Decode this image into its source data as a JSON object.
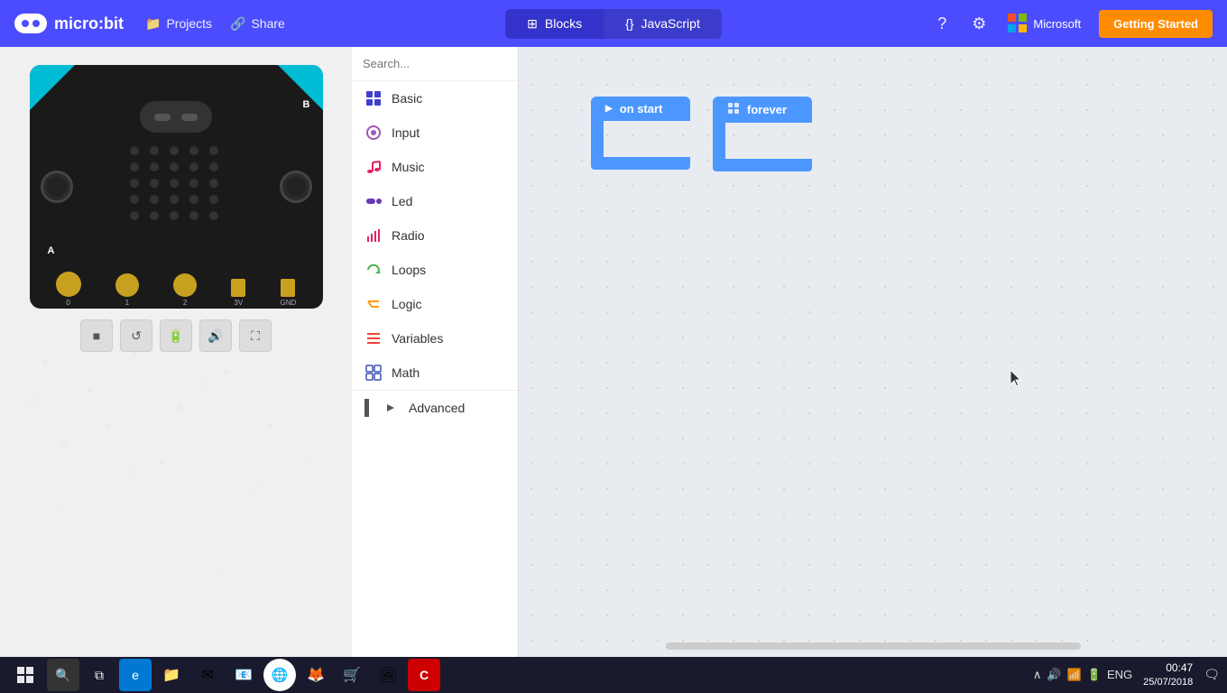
{
  "app": {
    "title": "micro:bit"
  },
  "topnav": {
    "logo_text": "micro:bit",
    "projects_label": "Projects",
    "share_label": "Share",
    "blocks_label": "Blocks",
    "javascript_label": "JavaScript",
    "help_icon": "?",
    "settings_icon": "⚙",
    "microsoft_label": "Microsoft",
    "getting_started_label": "Getting Started"
  },
  "sidebar": {
    "search_placeholder": "Search...",
    "items": [
      {
        "label": "Basic",
        "color": "#4040cc",
        "icon": "grid"
      },
      {
        "label": "Input",
        "color": "#b040b0",
        "icon": "circle"
      },
      {
        "label": "Music",
        "color": "#e91e63",
        "icon": "music"
      },
      {
        "label": "Led",
        "color": "#673ab7",
        "icon": "toggle"
      },
      {
        "label": "Radio",
        "color": "#e91e63",
        "icon": "radio"
      },
      {
        "label": "Loops",
        "color": "#4caf50",
        "icon": "loop"
      },
      {
        "label": "Logic",
        "color": "#ff9800",
        "icon": "logic"
      },
      {
        "label": "Variables",
        "color": "#f44336",
        "icon": "var"
      },
      {
        "label": "Math",
        "color": "#3f51b5",
        "icon": "math"
      },
      {
        "label": "Advanced",
        "color": "#607d8b",
        "icon": "chevron"
      }
    ]
  },
  "blocks": {
    "on_start_label": "on start",
    "forever_label": "forever"
  },
  "simulator": {
    "pin_labels": [
      "0",
      "1",
      "2",
      "3V",
      "GND"
    ]
  },
  "taskbar": {
    "time": "00:47",
    "date": "25/07/2018",
    "language": "ENG"
  }
}
